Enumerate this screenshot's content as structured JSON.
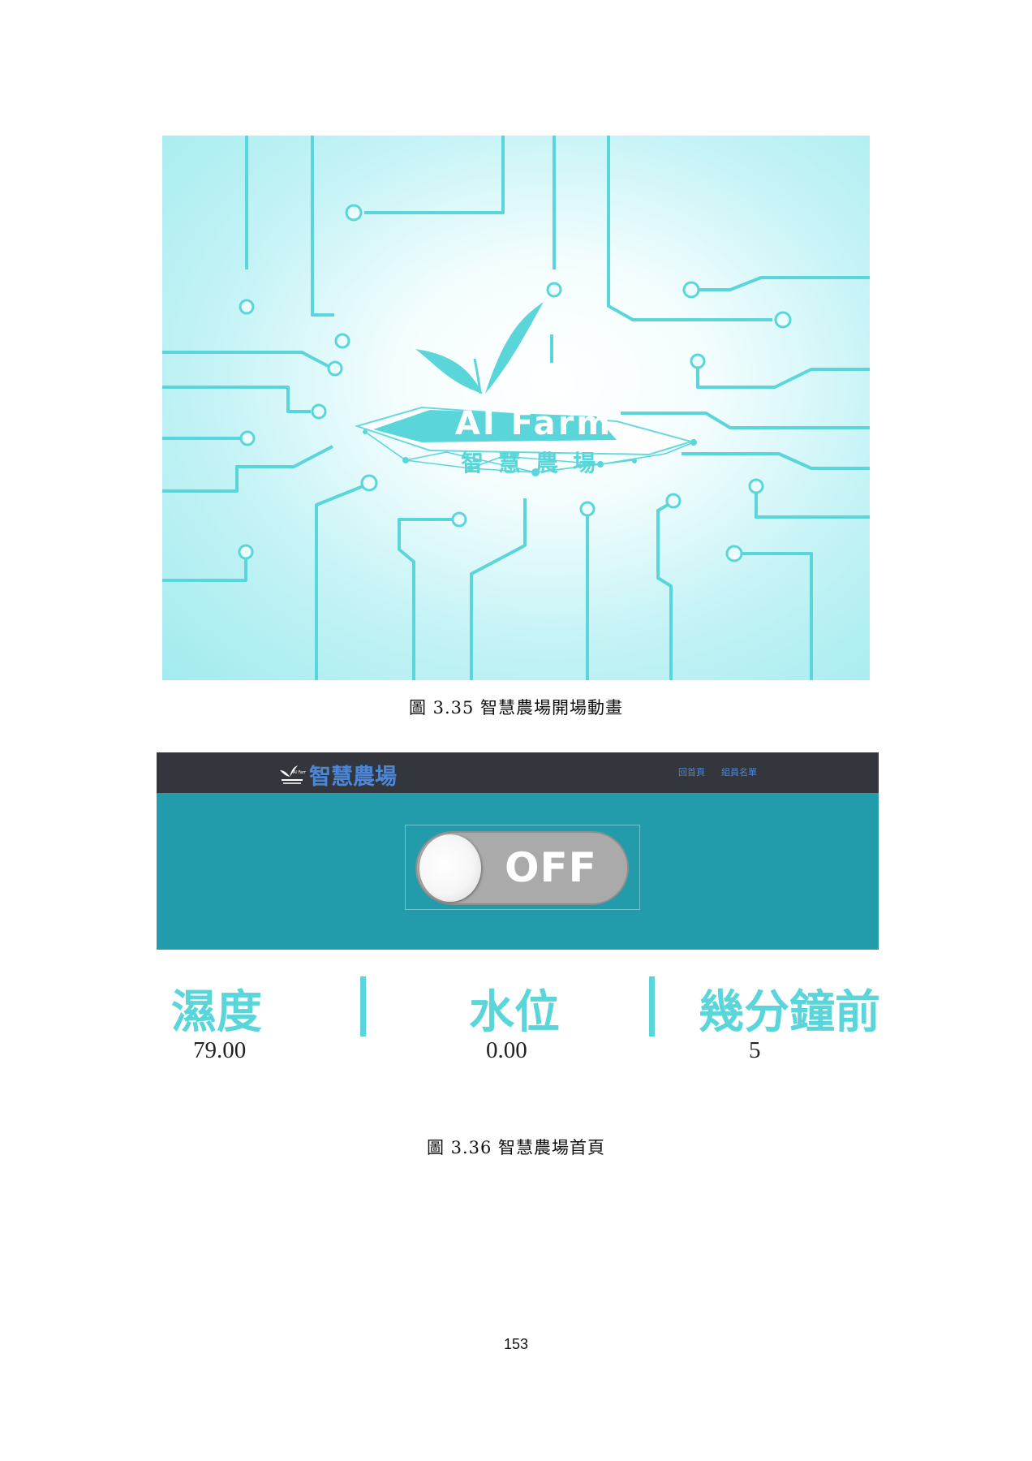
{
  "figure1": {
    "logo_text": "AI Farm",
    "logo_chinese": "智慧農場",
    "caption": "圖 3.35 智慧農場開場動畫"
  },
  "figure2": {
    "brand": {
      "name": "智慧農場",
      "icon": "sprout-logo-icon",
      "icon_text": "AI Farm 智慧農場"
    },
    "nav": [
      {
        "label": "回首頁"
      },
      {
        "label": "組員名單"
      }
    ],
    "toggle": {
      "state_label": "OFF",
      "on": false
    },
    "stats": [
      {
        "label": "濕度",
        "value": "79.00"
      },
      {
        "label": "水位",
        "value": "0.00"
      },
      {
        "label": "幾分鐘前",
        "value": "5"
      }
    ],
    "caption": "圖 3.36 智慧農場首頁"
  },
  "page_number": "153",
  "colors": {
    "navbar": "#33373d",
    "brand_blue": "#4d86d6",
    "hero_teal": "#229bab",
    "stat_cyan": "#5ad6da",
    "circuit": "#5ad6da",
    "toggle_grey": "#a9aaa9"
  }
}
